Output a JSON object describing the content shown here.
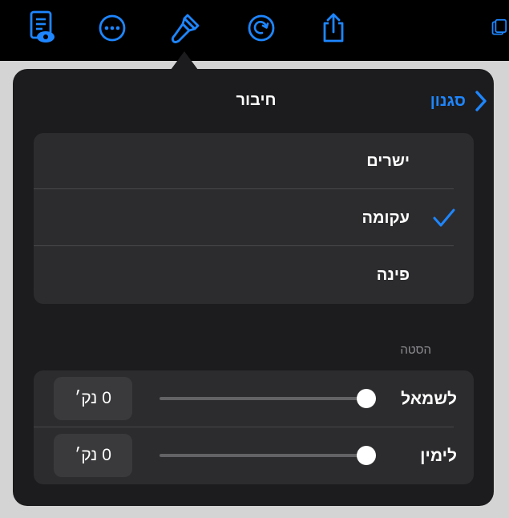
{
  "toolbar": {
    "items": [
      {
        "name": "document-view-icon"
      },
      {
        "name": "more-icon"
      },
      {
        "name": "format-brush-icon"
      },
      {
        "name": "redo-icon"
      },
      {
        "name": "share-icon"
      },
      {
        "name": "collaborate-icon"
      }
    ],
    "accent": "#1e86ff"
  },
  "popover": {
    "title": "חיבור",
    "back_label": "סגנון",
    "options": [
      {
        "label": "ישרים",
        "selected": false
      },
      {
        "label": "עקומה",
        "selected": true
      },
      {
        "label": "פינה",
        "selected": false
      }
    ],
    "offset_section_label": "הסטה",
    "offsets": [
      {
        "label": "לשמאל",
        "value_text": "0 נק׳",
        "slider_fraction": 1.0
      },
      {
        "label": "לימין",
        "value_text": "0 נק׳",
        "slider_fraction": 1.0
      }
    ]
  }
}
